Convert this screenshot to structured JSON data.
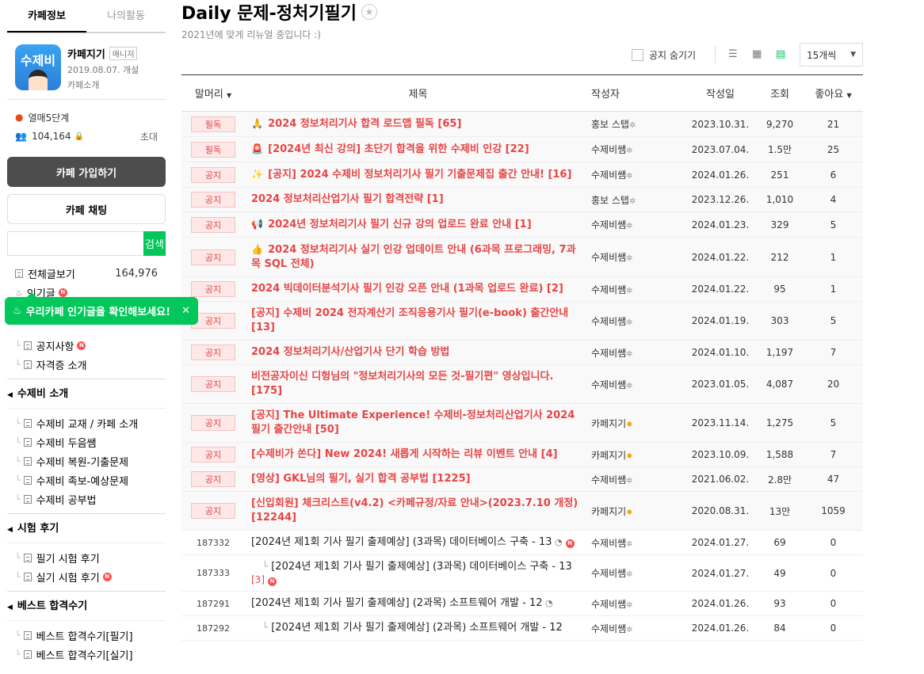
{
  "sidebar": {
    "tabs": [
      "카페정보",
      "나의활동"
    ],
    "logo_text": "수제비",
    "cafe_name": "카페지기",
    "manager_badge": "매니저",
    "opened": "2019.08.07. 개설",
    "intro": "카페소개",
    "rank": "열매5단계",
    "members": "104,164",
    "invite": "초대",
    "join_label": "카페 가입하기",
    "chat_label": "카페 채팅",
    "search_button": "검색",
    "all_posts": {
      "label": "전체글보기",
      "count": "164,976"
    },
    "popular": "인기글",
    "tooltip": "우리카페 인기글을 확인해보세요!",
    "tree1": [
      "공지사항",
      "자격증 소개"
    ],
    "groups": [
      {
        "title": "수제비 소개",
        "items": [
          "수제비 교재 / 카페 소개",
          "수제비 두음쌤",
          "수제비 복원-기출문제",
          "수제비 족보-예상문제",
          "수제비 공부법"
        ]
      },
      {
        "title": "시험 후기",
        "items": [
          "필기 시험 후기",
          "실기 시험 후기"
        ]
      },
      {
        "title": "베스트 합격수기",
        "items": [
          "베스트 합격수기[필기]",
          "베스트 합격수기[실기]"
        ]
      }
    ]
  },
  "main": {
    "title": "Daily 문제-정처기필기",
    "subtitle": "2021년에 맞게 리뉴얼 중입니다 :)",
    "hide_notice": "공지 숨기기",
    "per_page": "15개씩",
    "headers": {
      "head": "말머리",
      "title": "제목",
      "author": "작성자",
      "date": "작성일",
      "views": "조회",
      "likes": "좋아요"
    },
    "rows": [
      {
        "head": "필독",
        "emoji": "🙏",
        "title": "2024 정보처리기사 합격 로드맵 필독",
        "count": "[65]",
        "author": "홍보 스탭",
        "badge": "gear",
        "date": "2023.10.31.",
        "views": "9,270",
        "likes": "21"
      },
      {
        "head": "필독",
        "emoji": "🚨",
        "title": "[2024년 최신 강의] 초단기 합격을 위한 수제비 인강",
        "count": "[22]",
        "author": "수제비쌤",
        "badge": "gear",
        "date": "2023.07.04.",
        "views": "1.5만",
        "likes": "25"
      },
      {
        "head": "공지",
        "emoji": "✨",
        "title": "[공지] 2024 수제비 정보처리기사 필기 기출문제집 출간 안내!",
        "count": "[16]",
        "author": "수제비쌤",
        "badge": "gear",
        "date": "2024.01.26.",
        "views": "251",
        "likes": "6"
      },
      {
        "head": "공지",
        "emoji": "",
        "title": "2024 정보처리산업기사 필기 합격전략",
        "count": "[1]",
        "author": "홍보 스탭",
        "badge": "gear",
        "date": "2023.12.26.",
        "views": "1,010",
        "likes": "4"
      },
      {
        "head": "공지",
        "emoji": "📢",
        "title": "2024년 정보처리기사 필기 신규 강의 업로드 완료 안내",
        "count": "[1]",
        "author": "수제비쌤",
        "badge": "gear",
        "date": "2024.01.23.",
        "views": "329",
        "likes": "5"
      },
      {
        "head": "공지",
        "emoji": "👍",
        "title": "2024 정보처리기사 실기 인강 업데이트 안내 (6과목 프로그래밍, 7과목 SQL 전체)",
        "count": "",
        "author": "수제비쌤",
        "badge": "gear",
        "date": "2024.01.22.",
        "views": "212",
        "likes": "1"
      },
      {
        "head": "공지",
        "emoji": "",
        "title": "2024 빅데이터분석기사 필기 인강 오픈 안내 (1과목 업로드 완료)",
        "count": "[2]",
        "author": "수제비쌤",
        "badge": "gear",
        "date": "2024.01.22.",
        "views": "95",
        "likes": "1"
      },
      {
        "head": "공지",
        "emoji": "",
        "title": "[공지] 수제비 2024 전자계산기 조직응용기사 필기(e-book) 출간안내",
        "count": "[13]",
        "author": "수제비쌤",
        "badge": "gear",
        "date": "2024.01.19.",
        "views": "303",
        "likes": "5"
      },
      {
        "head": "공지",
        "emoji": "",
        "title": "2024 정보처리기사/산업기사 단기 학습 방법",
        "count": "",
        "author": "수제비쌤",
        "badge": "gear",
        "date": "2024.01.10.",
        "views": "1,197",
        "likes": "7"
      },
      {
        "head": "공지",
        "emoji": "",
        "title": "비전공자이신 디헝님의 \"정보처리기사의 모든 것-필기편\" 영상입니다.",
        "count": "[175]",
        "author": "수제비쌤",
        "badge": "gear",
        "date": "2023.01.05.",
        "views": "4,087",
        "likes": "20"
      },
      {
        "head": "공지",
        "emoji": "",
        "title": "[공지] The Ultimate Experience! 수제비-정보처리산업기사 2024 필기 출간안내",
        "count": "[50]",
        "author": "카페지기",
        "badge": "sun",
        "date": "2023.11.14.",
        "views": "1,275",
        "likes": "5"
      },
      {
        "head": "공지",
        "emoji": "",
        "title": "[수제비가 쏜다] New 2024! 새롭게 시작하는 리뷰 이벤트 안내",
        "count": "[4]",
        "author": "카페지기",
        "badge": "sun",
        "date": "2023.10.09.",
        "views": "1,588",
        "likes": "7"
      },
      {
        "head": "공지",
        "emoji": "",
        "title": "[영상] GKL님의 필기, 실기 합격 공부법",
        "count": "[1225]",
        "author": "수제비쌤",
        "badge": "gear",
        "date": "2021.06.02.",
        "views": "2.8만",
        "likes": "47"
      },
      {
        "head": "공지",
        "emoji": "",
        "title": "[신입회원] 체크리스트(v4.2) <카페규정/자료 안내>(2023.7.10 개정)",
        "count": "[12244]",
        "author": "카페지기",
        "badge": "sun",
        "date": "2020.08.31.",
        "views": "13만",
        "likes": "1059"
      }
    ],
    "posts": [
      {
        "num": "187332",
        "reply": false,
        "title": "[2024년 제1회 기사 필기 출제예상] (3과목) 데이터베이스 구축 - 13",
        "count": "",
        "quiz": true,
        "new": true,
        "author": "수제비쌤",
        "date": "2024.01.27.",
        "views": "69",
        "likes": "0"
      },
      {
        "num": "187333",
        "reply": true,
        "title": "[2024년 제1회 기사 필기 출제예상] (3과목) 데이터베이스 구축 - 13",
        "count": "[3]",
        "quiz": false,
        "new": true,
        "author": "수제비쌤",
        "date": "2024.01.27.",
        "views": "49",
        "likes": "0"
      },
      {
        "num": "187291",
        "reply": false,
        "title": "[2024년 제1회 기사 필기 출제예상] (2과목) 소프트웨어 개발 - 12",
        "count": "",
        "quiz": true,
        "new": false,
        "author": "수제비쌤",
        "date": "2024.01.26.",
        "views": "93",
        "likes": "0"
      },
      {
        "num": "187292",
        "reply": true,
        "title": "[2024년 제1회 기사 필기 출제예상] (2과목) 소프트웨어 개발 - 12",
        "count": "",
        "quiz": false,
        "new": false,
        "author": "수제비쌤",
        "date": "2024.01.26.",
        "views": "84",
        "likes": "0"
      }
    ]
  }
}
